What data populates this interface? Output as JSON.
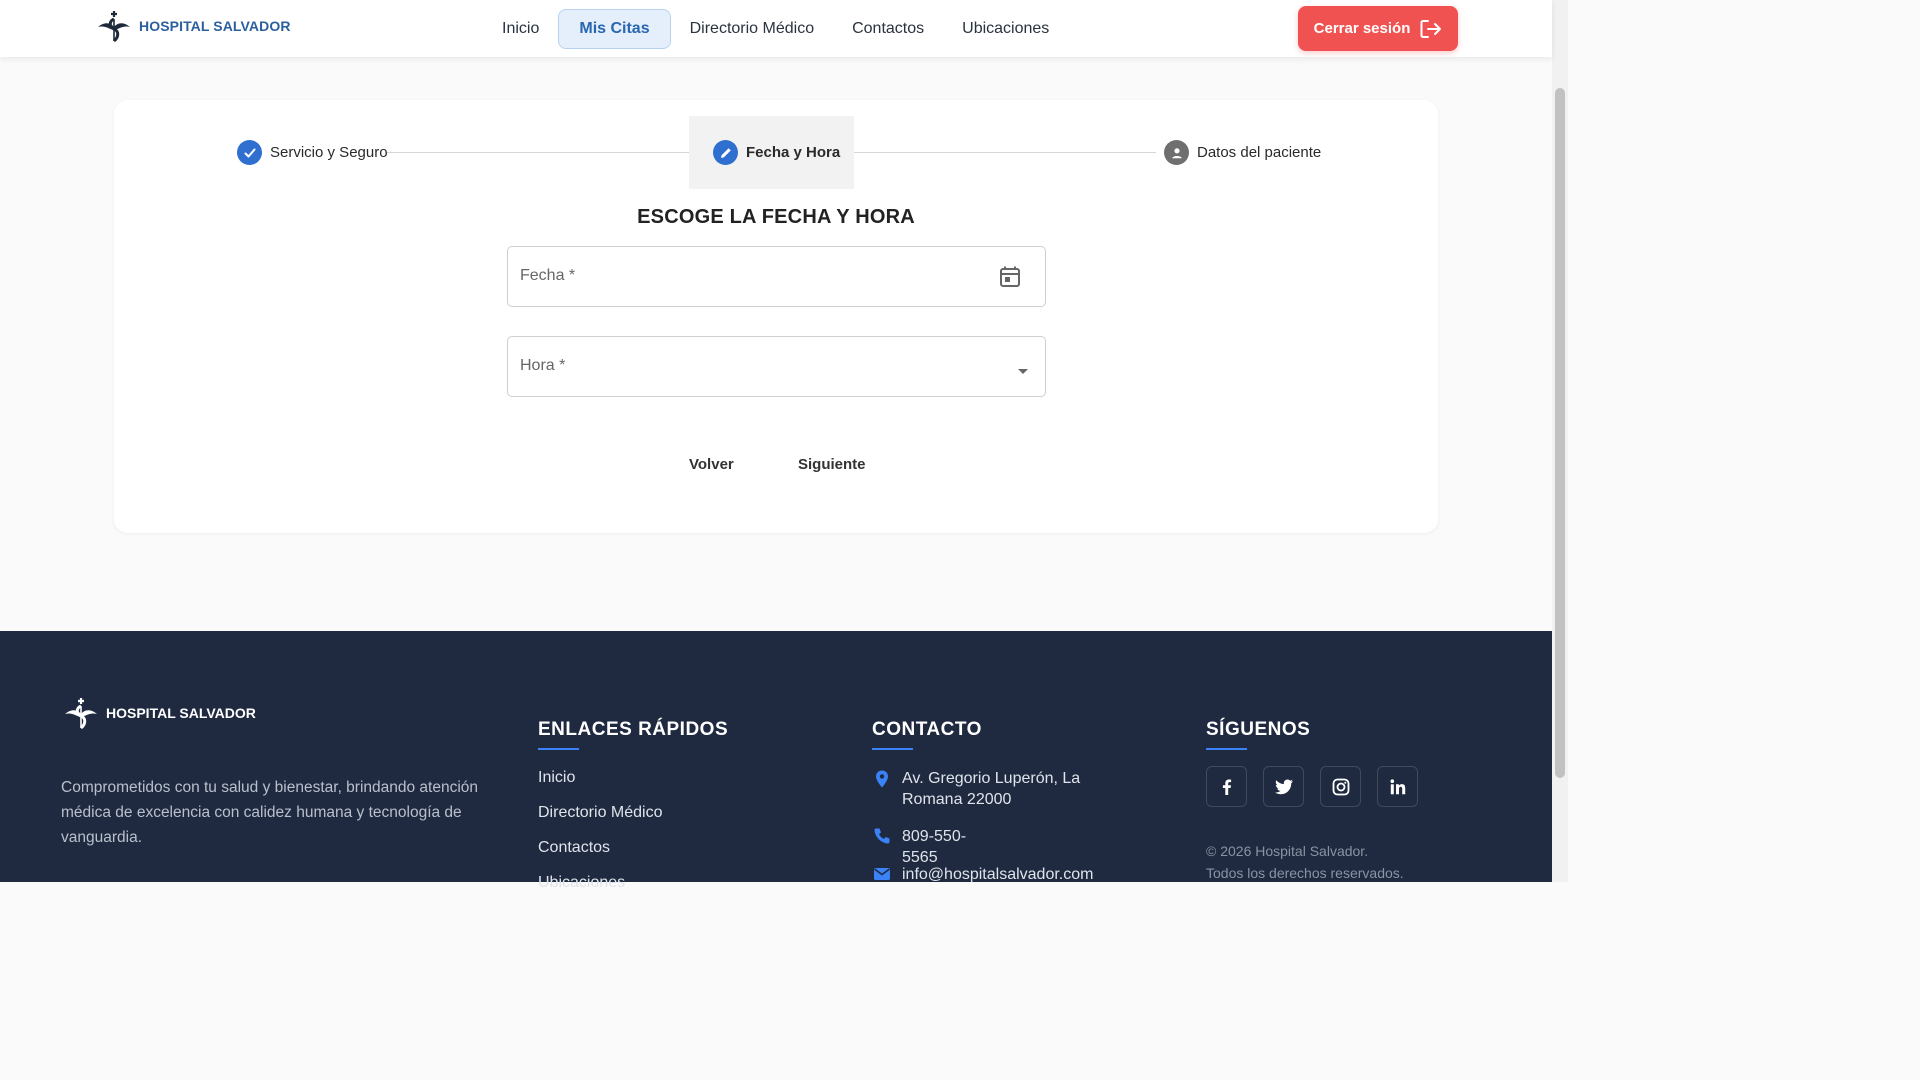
{
  "header": {
    "logo_text": "HOSPITAL SALVADOR",
    "nav": [
      "Inicio",
      "Mis Citas",
      "Directorio Médico",
      "Contactos",
      "Ubicaciones"
    ],
    "active_nav": "Mis Citas",
    "logout_label": "Cerrar sesión"
  },
  "stepper": {
    "steps": [
      {
        "label": "Servicio y Seguro",
        "state": "completed",
        "icon": "check-icon"
      },
      {
        "label": "Fecha y Hora",
        "state": "active",
        "icon": "pencil-icon"
      },
      {
        "label": "Datos del paciente",
        "state": "pending",
        "icon": "person-icon"
      }
    ]
  },
  "form": {
    "title": "ESCOGE LA FECHA Y HORA",
    "date_label": "Fecha *",
    "time_label": "Hora *",
    "back_label": "Volver",
    "next_label": "Siguiente"
  },
  "footer": {
    "logo_text": "HOSPITAL SALVADOR",
    "description": "Comprometidos con tu salud y bienestar, brindando atención médica de excelencia con calidez humana y tecnología de vanguardia.",
    "links_title": "ENLACES RÁPIDOS",
    "links": [
      "Inicio",
      "Directorio Médico",
      "Contactos",
      "Ubicaciones"
    ],
    "contact_title": "CONTACTO",
    "address": "Av. Gregorio Luperón, La Romana 22000",
    "phone": "809-550-5565",
    "email": "info@hospitalsalvador.com",
    "social_title": "SÍGUENOS",
    "socials": [
      "facebook-icon",
      "twitter-icon",
      "instagram-icon",
      "linkedin-icon"
    ],
    "copyright_line1": "© 2026 Hospital Salvador.",
    "copyright_line2": "Todos los derechos reservados."
  },
  "colors": {
    "primary": "#2b5f9e",
    "step_blue": "#2f6fd0",
    "logout_red": "#f05252",
    "footer_bg": "#1f2a40",
    "accent_bar": "#3b82f6"
  }
}
